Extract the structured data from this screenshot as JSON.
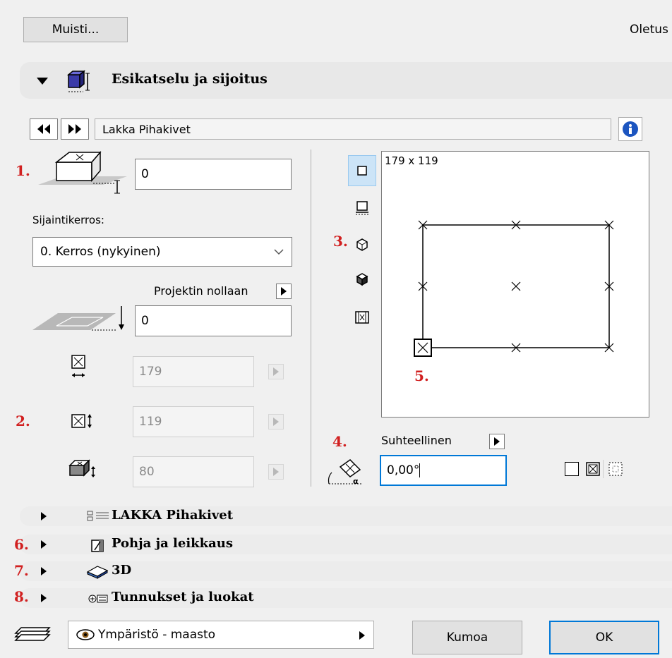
{
  "top": {
    "memory_button": "Muisti...",
    "default_label": "Oletus"
  },
  "preview_section": {
    "title": "Esikatselu ja sijoitus"
  },
  "object": {
    "name": "Lakka Pihakivet"
  },
  "markers": {
    "m1": "1.",
    "m2": "2.",
    "m3": "3.",
    "m4": "4.",
    "m5": "5.",
    "m6": "6.",
    "m7": "7.",
    "m8": "8."
  },
  "elevation": {
    "value": "0"
  },
  "floor": {
    "label": "Sijaintikerros:",
    "selected": "0. Kerros (nykyinen)"
  },
  "project_zero": {
    "label": "Projektin nollaan",
    "value": "0"
  },
  "dimensions": {
    "width": "179",
    "depth": "119",
    "height": "80"
  },
  "preview": {
    "size_label": "179 x 119"
  },
  "rotation": {
    "mode_label": "Suhteellinen",
    "value": "0,00°"
  },
  "sections": [
    {
      "label": "LAKKA Pihakivet"
    },
    {
      "label": "Pohja ja leikkaus"
    },
    {
      "label": "3D"
    },
    {
      "label": "Tunnukset ja luokat"
    }
  ],
  "footer": {
    "layer": "Ympäristö - maasto",
    "cancel": "Kumoa",
    "ok": "OK"
  },
  "colors": {
    "marker": "#d12020",
    "ok_border": "#0078d7",
    "focus_border": "#0078d7"
  }
}
